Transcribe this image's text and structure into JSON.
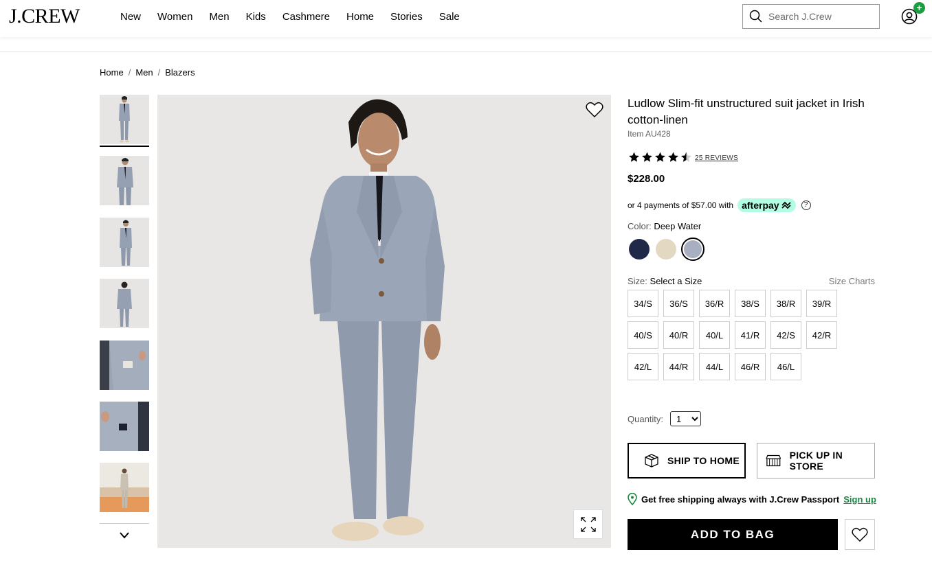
{
  "header": {
    "logo": "J.CREW",
    "nav": [
      "New",
      "Women",
      "Men",
      "Kids",
      "Cashmere",
      "Home",
      "Stories",
      "Sale"
    ],
    "search_placeholder": "Search J.Crew",
    "account_icon": "account-icon",
    "badge_icon": "plus-icon"
  },
  "breadcrumb": [
    "Home",
    "Men",
    "Blazers"
  ],
  "gallery": {
    "thumbnail_count": 7,
    "active_index": 0
  },
  "product": {
    "title": "Ludlow Slim-fit unstructured suit jacket in Irish cotton-linen",
    "item_number": "Item AU428",
    "rating": 4.5,
    "reviews_label": "25 REVIEWS",
    "price": "$228.00",
    "afterpay_text": "or 4 payments of $57.00 with",
    "afterpay_brand": "afterpay",
    "color_label": "Color:",
    "color_value": "Deep Water",
    "swatches": [
      {
        "color": "#202a48",
        "selected": false
      },
      {
        "color": "#e3d9c3",
        "selected": false
      },
      {
        "color": "#a7afc0",
        "selected": true
      }
    ],
    "size_label": "Size:",
    "size_value": "Select a Size",
    "size_charts": "Size Charts",
    "sizes": [
      "34/S",
      "36/S",
      "36/R",
      "38/S",
      "38/R",
      "39/R",
      "40/S",
      "40/R",
      "40/L",
      "41/R",
      "42/S",
      "42/R",
      "42/L",
      "44/R",
      "44/L",
      "46/R",
      "46/L"
    ],
    "quantity_label": "Quantity:",
    "quantity_value": "1",
    "ship_to_home": "SHIP TO HOME",
    "pick_up_in_store": "PICK UP IN STORE",
    "passport_text": "Get free shipping always with J.Crew Passport",
    "passport_link": "Sign up",
    "add_to_bag": "ADD TO BAG"
  },
  "colors": {
    "accent_green": "#1a8a43",
    "afterpay_mint": "#b2fce4",
    "primary": "#000000"
  }
}
